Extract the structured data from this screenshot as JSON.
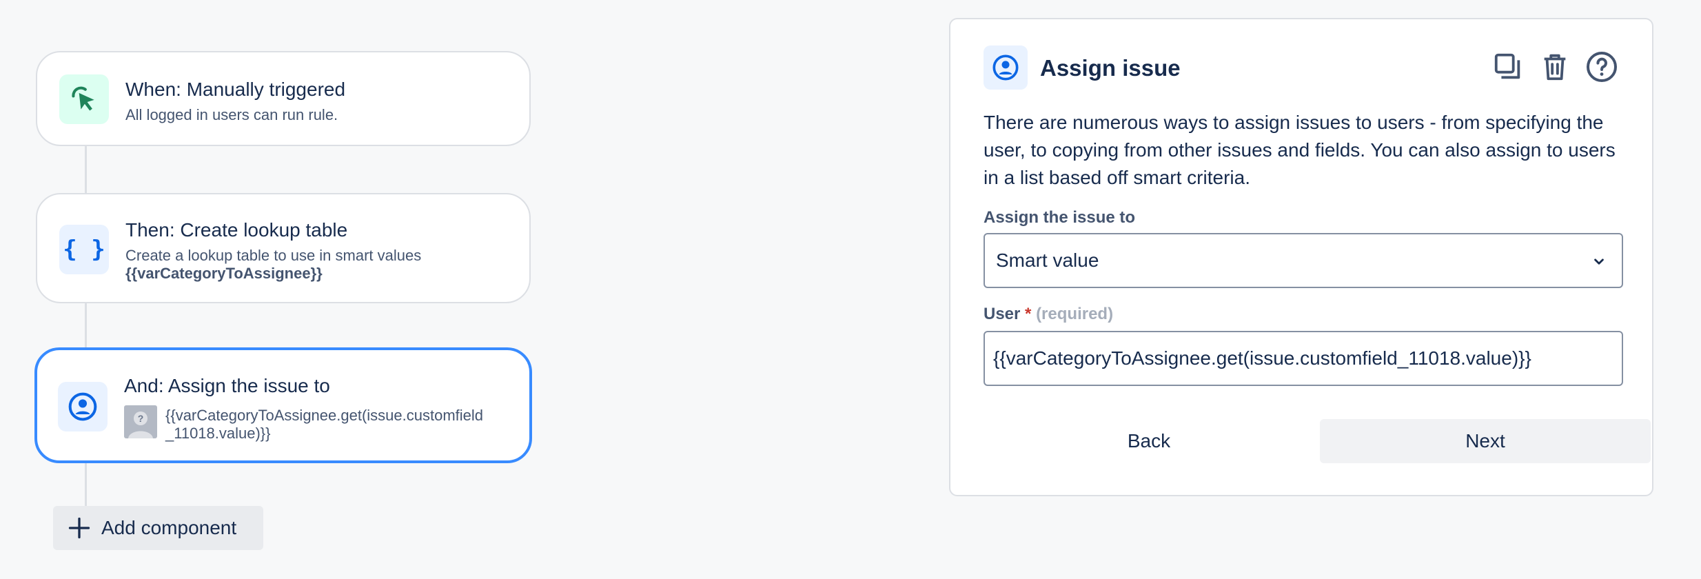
{
  "flow": {
    "trigger": {
      "title": "When: Manually triggered",
      "description": "All logged in users can run rule.",
      "icon": "cursor-click-icon",
      "tile_color": "#dcfff1",
      "icon_color": "#1f845a"
    },
    "lookup": {
      "title": "Then: Create lookup table",
      "description": "Create a lookup table to use in smart values",
      "variable": "{{varCategoryToAssignee}}",
      "icon": "braces-icon",
      "tile_color": "#e9f2ff",
      "icon_color": "#0c66e4"
    },
    "assign": {
      "title": "And: Assign the issue to",
      "value_line1": "{{varCategoryToAssignee.get(issue.customfield",
      "value_line2": "_11018.value)}}",
      "icon": "user-circle-icon",
      "avatar": "unknown-user-avatar",
      "tile_color": "#e9f2ff",
      "icon_color": "#0c66e4",
      "selected_border": "#388bff"
    },
    "add_component_label": "Add component"
  },
  "panel": {
    "title": "Assign issue",
    "icon": "user-circle-icon",
    "tools": [
      "duplicate-icon",
      "trash-icon",
      "help-icon"
    ],
    "description": "There are numerous ways to assign issues to users - from specifying the user, to copying from other issues and fields. You can also assign to users in a list based off smart criteria.",
    "assign_label": "Assign the issue to",
    "assign_value": "Smart value",
    "user_label": "User",
    "required_marker": "*",
    "required_hint": "(required)",
    "user_value": "{{varCategoryToAssignee.get(issue.customfield_11018.value)}}",
    "back_label": "Back",
    "next_label": "Next"
  }
}
